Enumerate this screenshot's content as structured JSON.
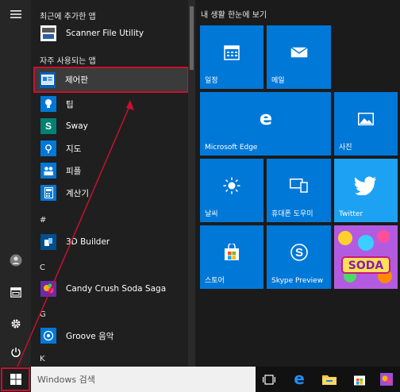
{
  "applist": {
    "recent_header": "최근에 추가한 앱",
    "frequent_header": "자주 사용되는 앱",
    "items": [
      {
        "label": "Scanner File Utility"
      },
      {
        "label": "제어판"
      },
      {
        "label": "팁"
      },
      {
        "label": "Sway"
      },
      {
        "label": "지도"
      },
      {
        "label": "피플"
      },
      {
        "label": "계산기"
      },
      {
        "label": "3D Builder"
      },
      {
        "label": "Candy Crush Soda Saga"
      },
      {
        "label": "Groove 음악"
      }
    ],
    "letters": [
      "#",
      "C",
      "G",
      "K"
    ]
  },
  "tiles": {
    "group_title": "내 생활 한눈에 보기",
    "items": [
      {
        "label": "일정"
      },
      {
        "label": "메일"
      },
      {
        "label": "Microsoft Edge"
      },
      {
        "label": "사진"
      },
      {
        "label": "날씨"
      },
      {
        "label": "휴대폰 도우미"
      },
      {
        "label": "Twitter"
      },
      {
        "label": "스토어"
      },
      {
        "label": "Skype Preview"
      },
      {
        "label": "SODA"
      }
    ]
  },
  "taskbar": {
    "search_placeholder": "Windows 검색"
  },
  "colors": {
    "tile_blue": "#0078d7",
    "highlight_red": "#c8102e"
  }
}
